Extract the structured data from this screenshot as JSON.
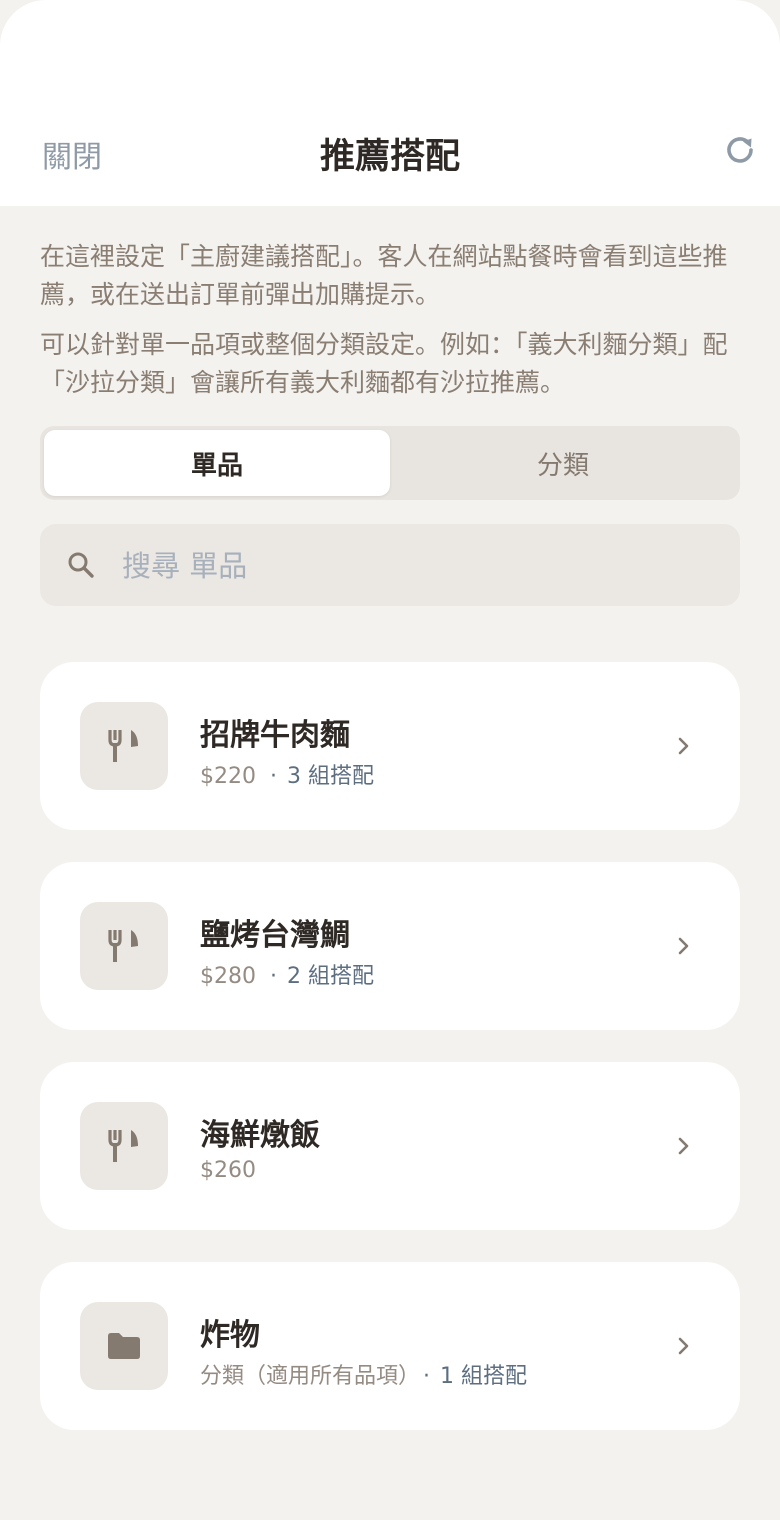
{
  "header": {
    "close_label": "關閉",
    "title": "推薦搭配",
    "refresh_icon": "refresh-icon"
  },
  "intro": {
    "paragraph1": "在這裡設定「主廚建議搭配」。客人在網站點餐時會看到這些推薦，或在送出訂單前彈出加購提示。",
    "paragraph2": "可以針對單一品項或整個分類設定。例如：「義大利麵分類」配「沙拉分類」會讓所有義大利麵都有沙拉推薦。"
  },
  "tabs": {
    "items": [
      {
        "label": "單品",
        "active": true
      },
      {
        "label": "分類",
        "active": false
      }
    ]
  },
  "search": {
    "placeholder": "搜尋 單品",
    "value": "",
    "icon": "search-icon"
  },
  "list": [
    {
      "name": "招牌牛肉麵",
      "meta": "$220",
      "pairs": "3 組搭配",
      "icon": "fork-knife-icon"
    },
    {
      "name": "鹽烤台灣鯛",
      "meta": "$280",
      "pairs": "2 組搭配",
      "icon": "fork-knife-icon"
    },
    {
      "name": "海鮮燉飯",
      "meta": "$260",
      "pairs": "",
      "icon": "fork-knife-icon"
    },
    {
      "name": "炸物",
      "meta": "分類（適用所有品項）",
      "pairs": "1 組搭配",
      "icon": "folder-icon"
    }
  ],
  "colors": {
    "background": "#f3f2ef",
    "card": "#ffffff",
    "accent_text": "#5c6e80",
    "muted_text": "#8a7e73",
    "icon": "#857a70"
  }
}
